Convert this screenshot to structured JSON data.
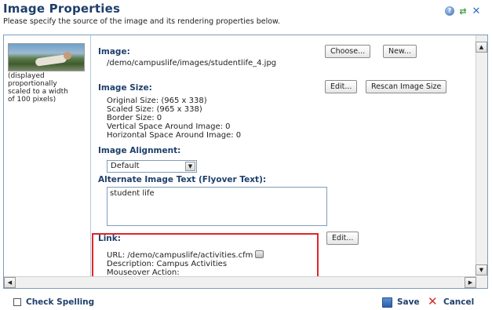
{
  "header": {
    "title": "Image Properties",
    "subtitle": "Please specify the source of the image and its rendering properties below."
  },
  "icons": {
    "help": "help-icon",
    "refresh": "refresh-icon",
    "close": "close-icon"
  },
  "thumbnail": {
    "note_lines": [
      "(displayed",
      "proportionally",
      "scaled to a width",
      "of 100 pixels)"
    ]
  },
  "image": {
    "label": "Image:",
    "path": "/demo/campuslife/images/studentlife_4.jpg",
    "choose_label": "Choose...",
    "new_label": "New..."
  },
  "image_size": {
    "label": "Image Size:",
    "edit_label": "Edit...",
    "rescan_label": "Rescan Image Size",
    "lines": [
      "Original Size: (965 x 338)",
      "Scaled Size: (965 x 338)",
      "Border Size: 0",
      "Vertical Space Around Image: 0",
      "Horizontal Space Around Image: 0"
    ]
  },
  "alignment": {
    "label": "Image Alignment:",
    "selected": "Default"
  },
  "alt_text": {
    "label": "Alternate Image Text (Flyover Text):",
    "value": "student life"
  },
  "link": {
    "label": "Link:",
    "edit_label": "Edit...",
    "url_line": "URL: /demo/campuslife/activities.cfm",
    "description_line": "Description: Campus Activities",
    "mouseover_line": "Mouseover Action:"
  },
  "footer": {
    "check_spelling": "Check Spelling",
    "save": "Save",
    "cancel": "Cancel"
  },
  "scrollbar_glyphs": {
    "up": "▲",
    "down": "▼",
    "left": "◀",
    "right": "▶"
  },
  "accent_colors": {
    "heading": "#1f3f6b",
    "highlight_box": "#e0252b",
    "border": "#7f9db9"
  }
}
